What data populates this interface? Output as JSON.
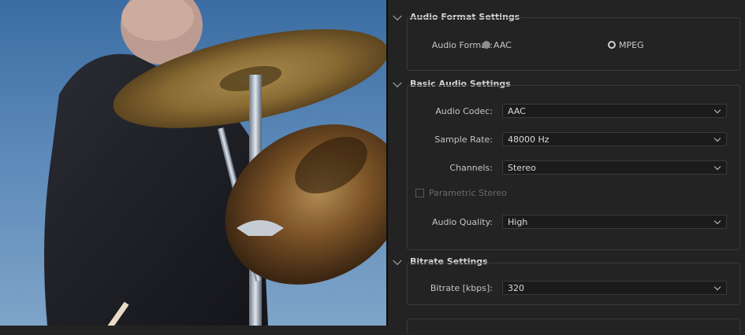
{
  "audio_format_settings": {
    "title": "Audio Format Settings",
    "label": "Audio Format:",
    "options": [
      {
        "label": "AAC",
        "selected": true
      },
      {
        "label": "MPEG",
        "selected": false
      }
    ]
  },
  "basic_audio_settings": {
    "title": "Basic Audio Settings",
    "audio_codec": {
      "label": "Audio Codec:",
      "value": "AAC"
    },
    "sample_rate": {
      "label": "Sample Rate:",
      "value": "48000 Hz"
    },
    "channels": {
      "label": "Channels:",
      "value": "Stereo"
    },
    "parametric_stereo": {
      "label": "Parametric Stereo",
      "checked": false,
      "enabled": false
    },
    "audio_quality": {
      "label": "Audio Quality:",
      "value": "High"
    }
  },
  "bitrate_settings": {
    "title": "Bitrate Settings",
    "bitrate": {
      "label": "Bitrate [kbps]:",
      "value": "320"
    }
  },
  "colors": {
    "panel_bg": "#232323",
    "field_bg": "#1b1b1b",
    "border": "#3a3a3a",
    "text": "#cfcfcf"
  }
}
